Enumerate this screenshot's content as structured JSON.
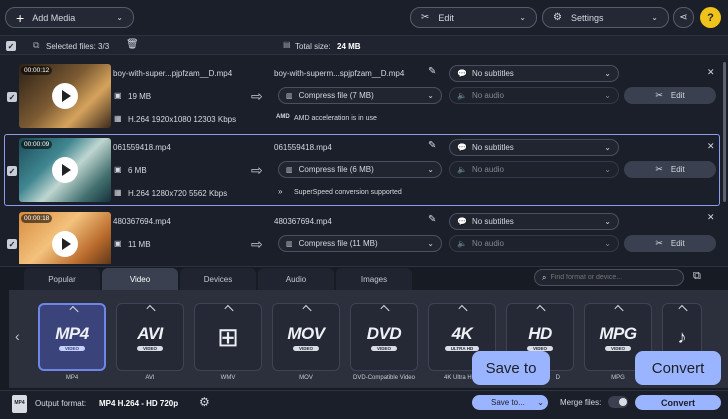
{
  "toolbar": {
    "add_media": "Add Media",
    "edit": "Edit",
    "settings": "Settings",
    "help": "?"
  },
  "selection": {
    "selected_label": "Selected files: 3/3",
    "total_label": "Total size:",
    "total_value": "24 MB"
  },
  "files": [
    {
      "duration": "00:00:12",
      "name": "boy-with-super...pjpfzam__D.mp4",
      "output_name": "boy-with-superm...spjpfzam__D.mp4",
      "size": "19 MB",
      "specs": "H.264 1920x1080 12303 Kbps",
      "compress": "Compress file (7 MB)",
      "subtitles": "No subtitles",
      "audio": "No audio",
      "accel": "AMD acceleration is in use",
      "accel_icon": "AMD",
      "edit": "Edit"
    },
    {
      "duration": "00:00:09",
      "name": "061559418.mp4",
      "output_name": "061559418.mp4",
      "size": "6 MB",
      "specs": "H.264 1280x720 5562 Kbps",
      "compress": "Compress file (6 MB)",
      "subtitles": "No subtitles",
      "audio": "No audio",
      "accel": "SuperSpeed conversion supported",
      "edit": "Edit"
    },
    {
      "duration": "00:00:18",
      "name": "480367694.mp4",
      "output_name": "480367694.mp4",
      "size": "11 MB",
      "compress": "Compress file (11 MB)",
      "subtitles": "No subtitles",
      "audio": "No audio",
      "edit": "Edit"
    }
  ],
  "tabs": [
    "Popular",
    "Video",
    "Devices",
    "Audio",
    "Images"
  ],
  "search_placeholder": "Find format or device...",
  "formats": [
    {
      "logo": "MP4",
      "sub": "VIDEO",
      "label": "MP4"
    },
    {
      "logo": "AVI",
      "sub": "VIDEO",
      "label": "AVI"
    },
    {
      "logo": "",
      "sub": "",
      "label": "WMV"
    },
    {
      "logo": "MOV",
      "sub": "VIDEO",
      "label": "MOV"
    },
    {
      "logo": "DVD",
      "sub": "VIDEO",
      "label": "DVD-Compatible Video"
    },
    {
      "logo": "4K",
      "sub": "ULTRA HD",
      "label": "4K Ultra H"
    },
    {
      "logo": "HD",
      "sub": "VIDEO",
      "label": "D"
    },
    {
      "logo": "MPG",
      "sub": "VIDEO",
      "label": "MPG"
    }
  ],
  "bottom": {
    "output_label": "Output format:",
    "output_value": "MP4 H.264 - HD 720p",
    "save_to": "Save to...",
    "merge": "Merge files:",
    "convert": "Convert",
    "tooltip_save": "Save to",
    "tooltip_convert": "Convert",
    "output_icon_text": "MP4"
  },
  "colors": {
    "accent": "#6f86e8",
    "tooltip": "#9bb4ff",
    "bg": "#1b1f29"
  }
}
